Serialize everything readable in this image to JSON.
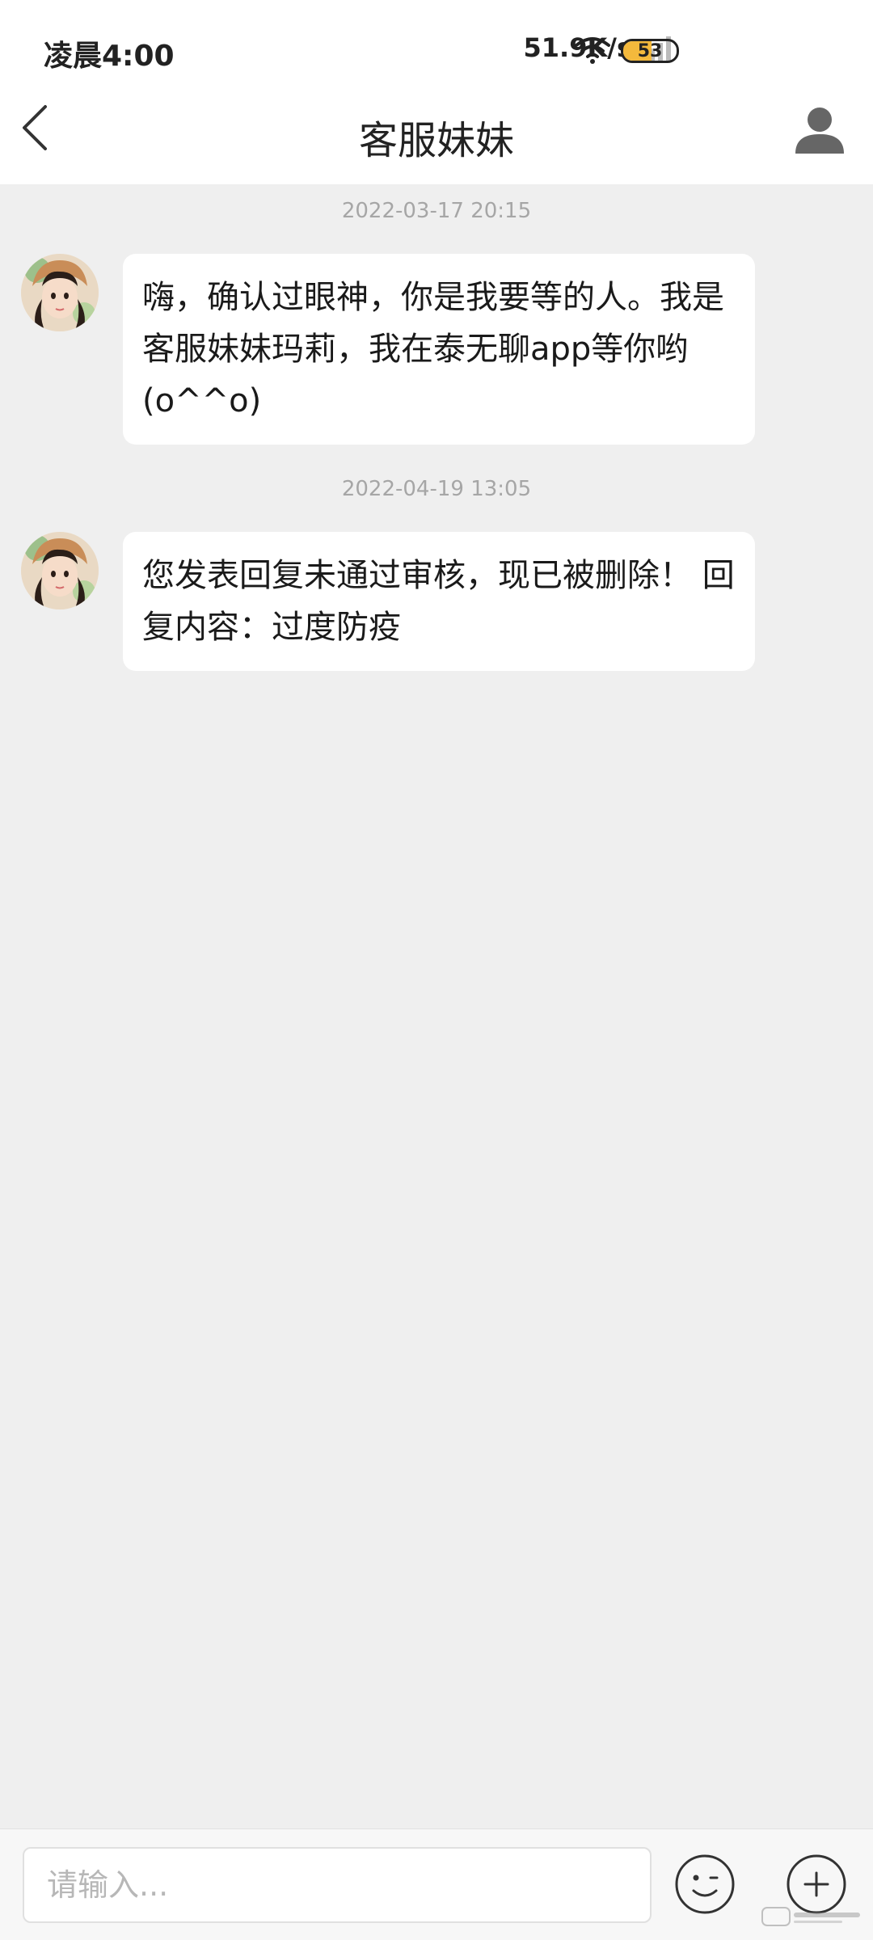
{
  "status_bar": {
    "time": "凌晨4:00",
    "net_speed": "51.9K/s",
    "battery_level": "53",
    "battery_fraction": 0.53,
    "icons": [
      "signal-icon",
      "wifi-icon",
      "battery-icon"
    ]
  },
  "header": {
    "title": "客服妹妹",
    "back_icon": "chevron-left-icon",
    "profile_icon": "person-icon"
  },
  "messages": [
    {
      "timestamp": "2022-03-17 20:15",
      "sender_avatar": "avatar",
      "text": "嗨，确认过眼神，你是我要等的人。我是客服妹妹玛莉，我在泰无聊app等你哟(o^^o)"
    },
    {
      "timestamp": "2022-04-19 13:05",
      "sender_avatar": "avatar",
      "text": "您发表回复未通过审核，现已被删除！ 回复内容：过度防疫"
    }
  ],
  "input_bar": {
    "placeholder": "请输入...",
    "emoji_icon": "smiley-icon",
    "add_icon": "plus-icon"
  },
  "colors": {
    "background": "#efefef",
    "bubble": "#ffffff",
    "timestamp": "#a6a6a6",
    "battery": "#f4b93c"
  }
}
